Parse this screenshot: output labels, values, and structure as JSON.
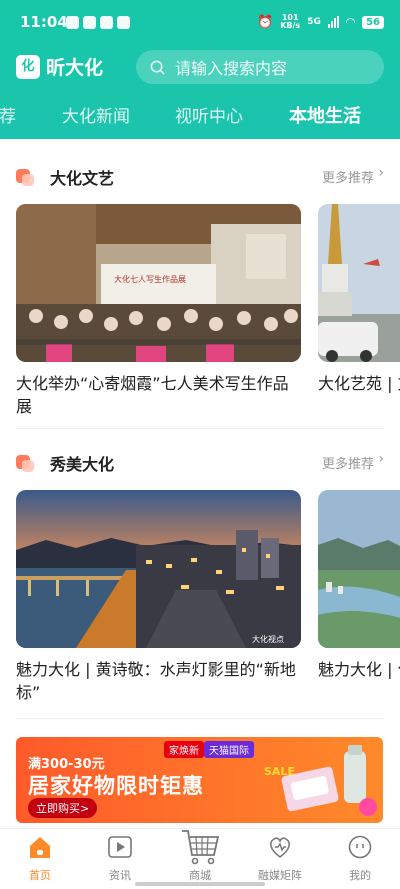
{
  "status_bar": {
    "time": "11:04",
    "net_speed": "101",
    "net_unit": "KB/s",
    "signal": "5G",
    "battery": "56"
  },
  "app": {
    "name": "昕大化",
    "logo_text": "化"
  },
  "search": {
    "placeholder": "请输入搜索内容"
  },
  "tabs": [
    {
      "label": "推荐",
      "active": false
    },
    {
      "label": "大化新闻",
      "active": false
    },
    {
      "label": "视听中心",
      "active": false
    },
    {
      "label": "本地生活",
      "active": true
    }
  ],
  "sections": [
    {
      "title": "大化文艺",
      "more": "更多推荐",
      "cards": [
        {
          "title": "大化举办“心寄烟霞”七人美术写生作品展",
          "banner": "大化七人写生作品展"
        },
        {
          "title": "大化艺苑 | 文）"
        }
      ]
    },
    {
      "title": "秀美大化",
      "more": "更多推荐",
      "cards": [
        {
          "title": "魅力大化 | 黄诗敬：水声灯影里的“新地标”",
          "watermark": "大化视点"
        },
        {
          "title": "魅力大化 | 化云雾鹤家"
        }
      ]
    }
  ],
  "ad": {
    "tag1": "家焕新",
    "tag2": "天猫国际",
    "subhead": "满300-30元",
    "headline": "居家好物限时钜惠",
    "button": "立即购买>",
    "badge": "SALE"
  },
  "bottom_nav": [
    {
      "label": "首页",
      "icon": "home-icon",
      "active": true
    },
    {
      "label": "资讯",
      "icon": "play-icon",
      "active": false
    },
    {
      "label": "商城",
      "icon": "cart-icon",
      "active": false
    },
    {
      "label": "融媒矩阵",
      "icon": "heart-icon",
      "active": false
    },
    {
      "label": "我的",
      "icon": "smile-icon",
      "active": false
    }
  ],
  "colors": {
    "brand": "#17c7a8",
    "accent": "#ff8a2a",
    "ad": "#ff5a2b"
  }
}
